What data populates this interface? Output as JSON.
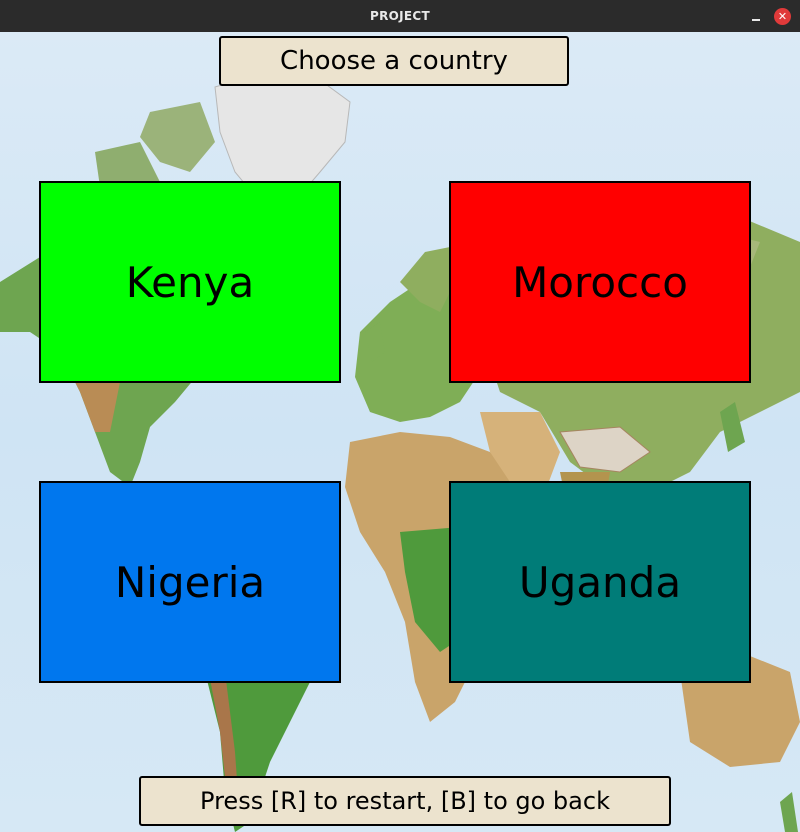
{
  "window": {
    "title": "PROJECT",
    "close_glyph": "✕"
  },
  "header": {
    "prompt": "Choose a country"
  },
  "countries": [
    {
      "label": "Kenya",
      "color": "#00ff00"
    },
    {
      "label": "Morocco",
      "color": "#ff0000"
    },
    {
      "label": "Nigeria",
      "color": "#0077ee"
    },
    {
      "label": "Uganda",
      "color": "#007c78"
    }
  ],
  "footer": {
    "hint": "Press [R] to restart, [B] to go back"
  },
  "colors": {
    "ocean": "#cfe4f4",
    "land_green": "#5aa04a",
    "land_tan": "#c9a46a",
    "land_brown": "#8a5a35",
    "ice": "#e8e8e8",
    "panel_bg": "#ece3ce"
  },
  "icons": {
    "minimize": "minimize-icon",
    "close": "close-icon"
  }
}
